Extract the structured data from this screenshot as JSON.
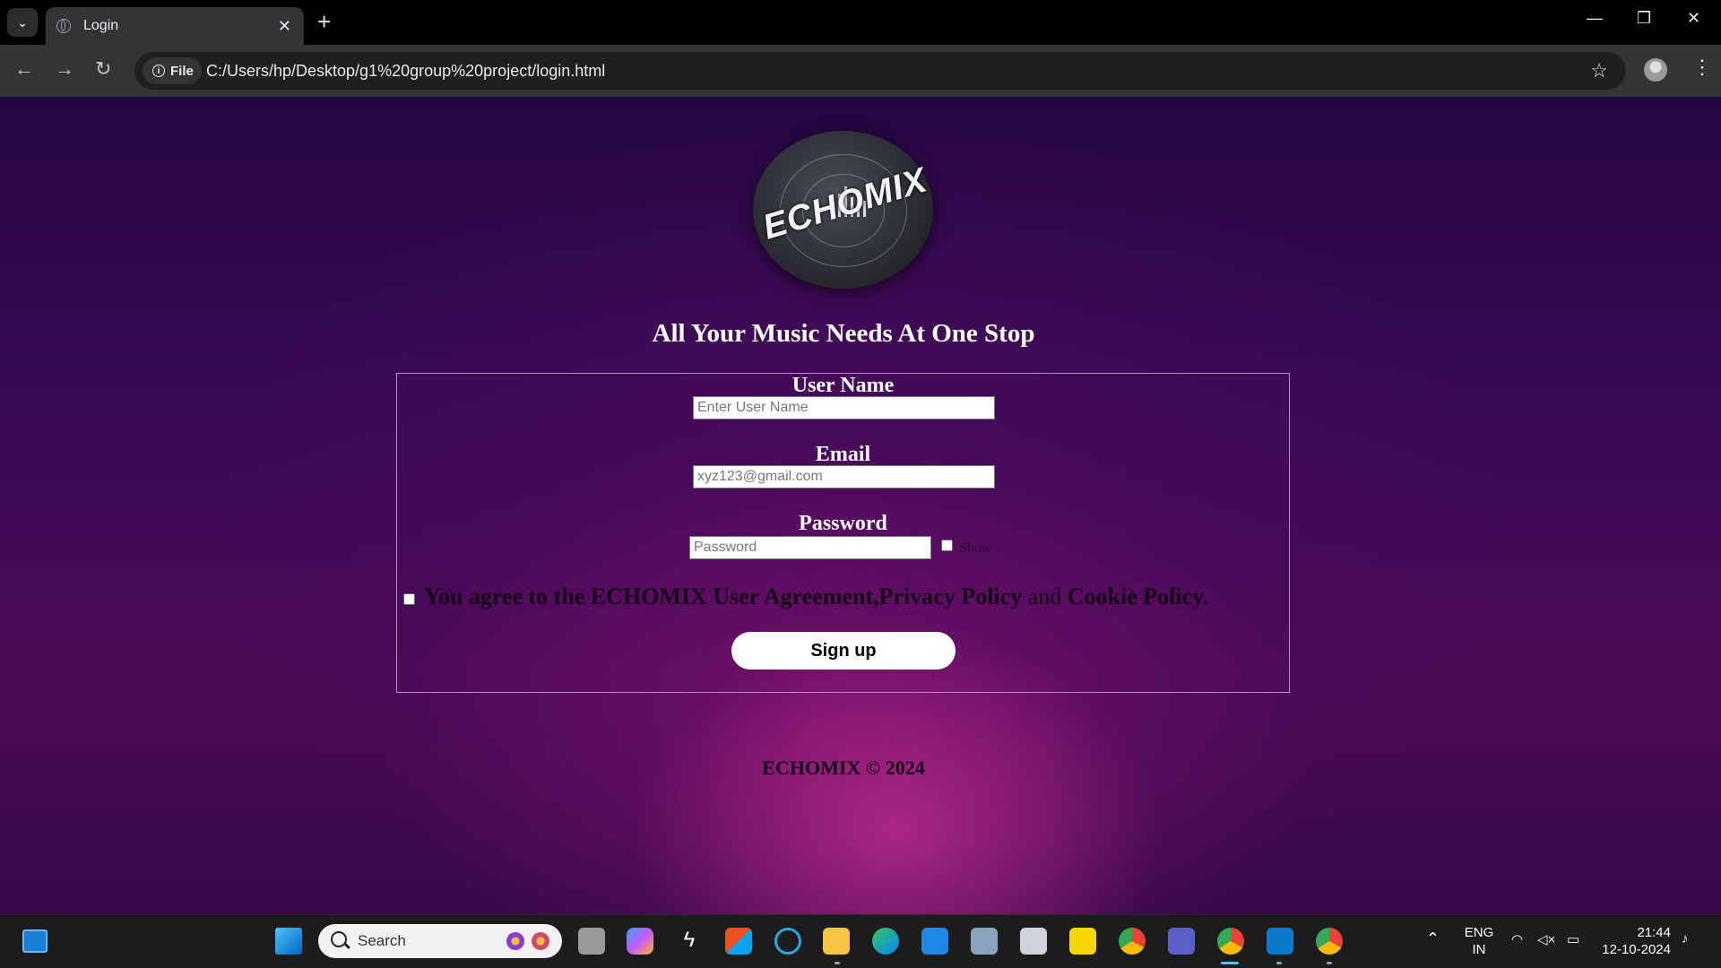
{
  "browser": {
    "tab_title": "Login",
    "new_tab_symbol": "+",
    "file_chip_label": "File",
    "url": "C:/Users/hp/Desktop/g1%20group%20project/login.html"
  },
  "page": {
    "logo_text": "ECHOMIX",
    "tagline": "All Your Music Needs At One Stop",
    "form": {
      "username_label": "User Name",
      "username_placeholder": "Enter User Name",
      "email_label": "Email",
      "email_placeholder": "xyz123@gmail.com",
      "password_label": "Password",
      "password_placeholder": "Password",
      "show_label": "Show",
      "agree_text_1": "You agree to the ECHOMIX User Agreement,Privacy Policy",
      "agree_text_and": " and ",
      "agree_text_2": "Cookie Policy.",
      "signup_label": "Sign up"
    },
    "footer": "ECHOMIX © 2024"
  },
  "taskbar": {
    "search_label": "Search",
    "language_line1": "ENG",
    "language_line2": "IN",
    "time": "21:44",
    "date": "12-10-2024"
  }
}
